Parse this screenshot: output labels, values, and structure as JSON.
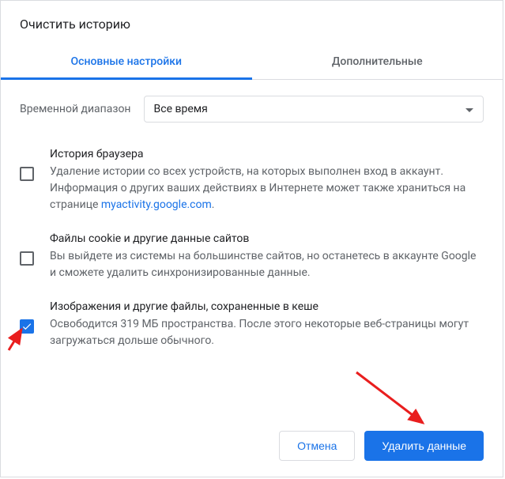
{
  "dialog": {
    "title": "Очистить историю"
  },
  "tabs": {
    "basic": "Основные настройки",
    "advanced": "Дополнительные"
  },
  "time_range": {
    "label": "Временной диапазон",
    "selected": "Все время"
  },
  "options": {
    "history": {
      "title": "История браузера",
      "desc_part1": "Удаление истории со всех устройств, на которых выполнен вход в аккаунт. Информация о других ваших действиях в Интернете может также храниться на странице ",
      "link": "myactivity.google.com",
      "desc_part2": ".",
      "checked": false
    },
    "cookies": {
      "title": "Файлы cookie и другие данные сайтов",
      "desc": "Вы выйдете из системы на большинстве сайтов, но останетесь в аккаунте Google и сможете удалить синхронизированные данные.",
      "checked": false
    },
    "cache": {
      "title": "Изображения и другие файлы, сохраненные в кеше",
      "desc": "Освободится 319 МБ пространства. После этого некоторые веб-страницы могут загружаться дольше обычного.",
      "checked": true
    }
  },
  "actions": {
    "cancel": "Отмена",
    "clear": "Удалить данные"
  }
}
